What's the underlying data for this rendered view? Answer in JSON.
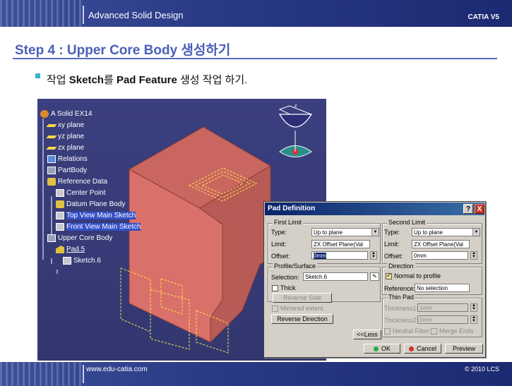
{
  "slide": {
    "header_title": "Advanced Solid Design",
    "header_right": "CATIA V5",
    "step_title": "Step 4 : Upper Core Body 생성하기",
    "bullet": {
      "part1": "작업 ",
      "part2": "Sketch",
      "part3": "를 ",
      "part4": "Pad Feature",
      "part5": " 생성 작업 하기."
    },
    "footer_url": "www.edu-catia.com",
    "footer_copy": "© 2010 LCS"
  },
  "tree": [
    {
      "label": "A Solid EX14",
      "icon": "part-icon"
    },
    {
      "label": "xy plane",
      "icon": "plane-icon"
    },
    {
      "label": "yz plane",
      "icon": "plane-icon"
    },
    {
      "label": "zx plane",
      "icon": "plane-icon"
    },
    {
      "label": "Relations",
      "icon": "relations-icon"
    },
    {
      "label": "PartBody",
      "icon": "body-icon"
    },
    {
      "label": "Reference Data",
      "icon": "geometric-set-icon"
    },
    {
      "label": "Center Point",
      "icon": "sketch-icon"
    },
    {
      "label": "Datum Plane Body",
      "icon": "geometric-set-icon"
    },
    {
      "label": "Top View Main Sketch",
      "icon": "sketch-icon"
    },
    {
      "label": "Front View Main Sketch",
      "icon": "sketch-icon"
    },
    {
      "label": "Upper Core Body",
      "icon": "body-icon"
    },
    {
      "label": "Pad.5",
      "icon": "pad-icon"
    },
    {
      "label": "Sketch.6",
      "icon": "sketch-icon"
    }
  ],
  "dialog": {
    "title": "Pad Definition",
    "help": "?",
    "close": "X",
    "first_limit": {
      "title": "First Limit",
      "type_label": "Type:",
      "type_value": "Up to plane",
      "limit_label": "Limit:",
      "limit_value": "ZX Offset Plane(Val",
      "offset_label": "Offset:",
      "offset_value": "0mm"
    },
    "profile": {
      "title": "Profile/Surface",
      "selection_label": "Selection:",
      "selection_value": "Sketch.6",
      "thick_label": "Thick",
      "reverse_side": "Reverse Side"
    },
    "mirrored_extent": "Mirrored extent",
    "reverse_direction": "Reverse Direction",
    "second_limit": {
      "title": "Second Limit",
      "type_label": "Type:",
      "type_value": "Up to plane",
      "limit_label": "Limit:",
      "limit_value": "ZX Offset Plane(Val",
      "offset_label": "Offset:",
      "offset_value": "0mm"
    },
    "direction": {
      "title": "Direction",
      "normal_label": "Normal to profile",
      "reference_label": "Reference:",
      "reference_value": "No selection"
    },
    "thin_pad": {
      "title": "Thin Pad",
      "thickness1_label": "Thickness1:",
      "thickness1_value": "1mm",
      "thickness2_label": "Thickness2:",
      "thickness2_value": "0mm",
      "neutral_fiber": "Neutral Fiber",
      "merge_ends": "Merge Ends"
    },
    "less_button": "<<Less",
    "ok_button": "OK",
    "cancel_button": "Cancel",
    "preview_button": "Preview"
  },
  "colors": {
    "header": "#2a3a86",
    "accent": "#4a5fb8",
    "bullet": "#3ab4c8",
    "viewport": "#363a76",
    "model_front": "#d9706a",
    "dialog_bg": "#d4d0c8",
    "titlebar": "#0a246a"
  }
}
